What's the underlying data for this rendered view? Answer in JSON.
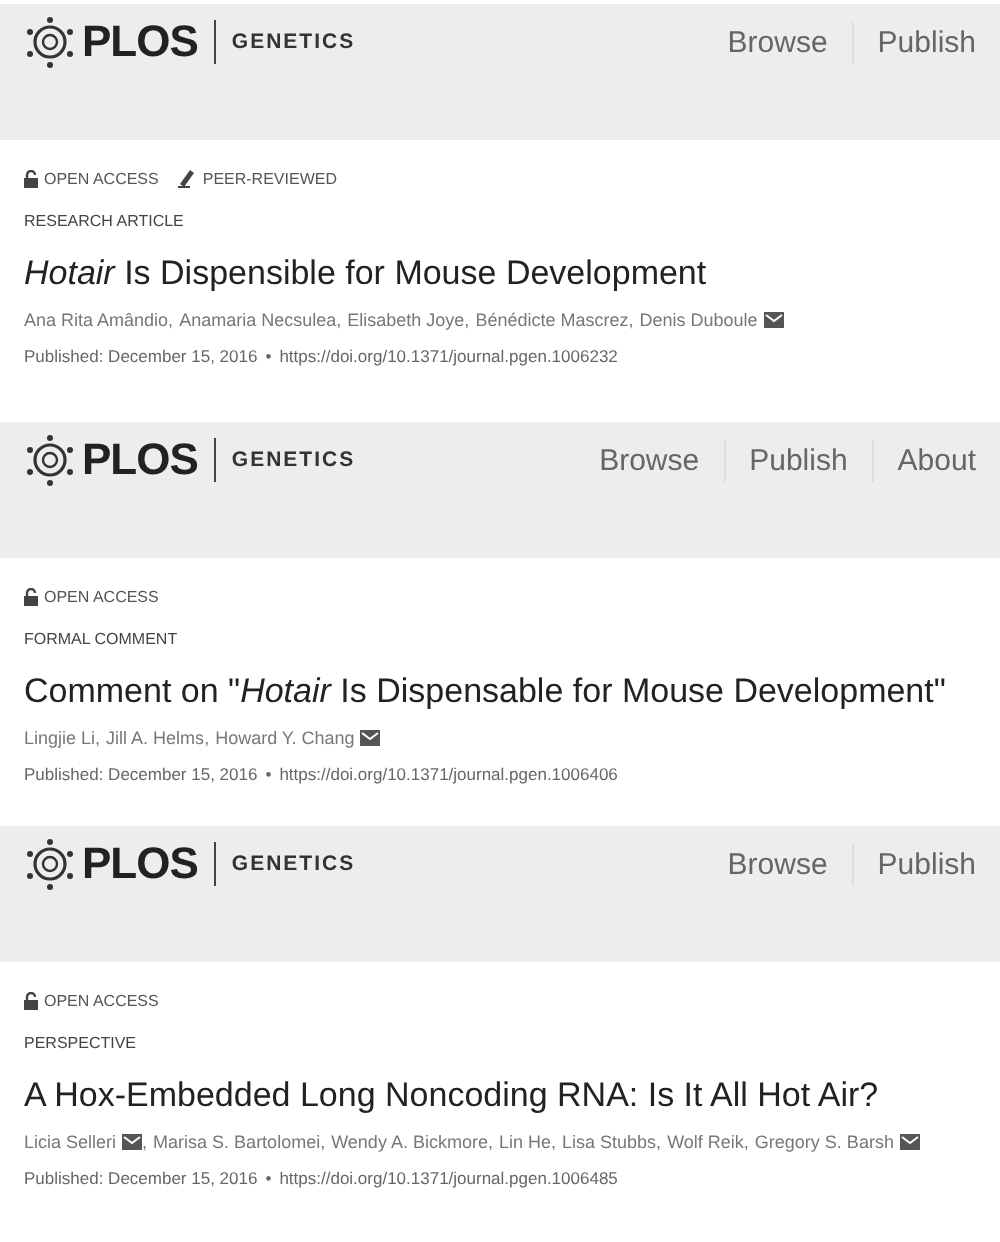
{
  "pages": [
    {
      "logo": {
        "brand": "PLOS",
        "journal": "GENETICS"
      },
      "nav": [
        "Browse",
        "Publish"
      ],
      "badges": [
        {
          "kind": "open-access",
          "label": "OPEN ACCESS"
        },
        {
          "kind": "peer-reviewed",
          "label": "PEER-REVIEWED"
        }
      ],
      "article_type": "RESEARCH ARTICLE",
      "title": "*Hotair* Is Dispensible for Mouse Development",
      "authors": [
        {
          "name": "Ana Rita Amândio",
          "corresponding": false,
          "sep": ","
        },
        {
          "name": "Anamaria Necsulea",
          "corresponding": false,
          "sep": ","
        },
        {
          "name": "Elisabeth Joye",
          "corresponding": false,
          "sep": ","
        },
        {
          "name": "Bénédicte Mascrez",
          "corresponding": false,
          "sep": ","
        },
        {
          "name": "Denis Duboule",
          "corresponding": true
        }
      ],
      "published": "Published: December 15, 2016",
      "bullet": "•",
      "doi": "https://doi.org/10.1371/journal.pgen.1006232"
    },
    {
      "logo": {
        "brand": "PLOS",
        "journal": "GENETICS"
      },
      "nav": [
        "Browse",
        "Publish",
        "About"
      ],
      "badges": [
        {
          "kind": "open-access",
          "label": "OPEN ACCESS"
        }
      ],
      "article_type": "FORMAL COMMENT",
      "title": "Comment on \"*Hotair* Is Dispensable for Mouse Development\"",
      "authors": [
        {
          "name": "Lingjie Li",
          "corresponding": false,
          "sep": ","
        },
        {
          "name": "Jill A. Helms",
          "corresponding": false,
          "sep": ","
        },
        {
          "name": "Howard Y. Chang",
          "corresponding": true
        }
      ],
      "published": "Published: December 15, 2016",
      "bullet": "•",
      "doi": "https://doi.org/10.1371/journal.pgen.1006406"
    },
    {
      "logo": {
        "brand": "PLOS",
        "journal": "GENETICS"
      },
      "nav": [
        "Browse",
        "Publish"
      ],
      "badges": [
        {
          "kind": "open-access",
          "label": "OPEN ACCESS"
        }
      ],
      "article_type": "PERSPECTIVE",
      "title": "A Hox-Embedded Long Noncoding RNA: Is It All Hot Air?",
      "authors": [
        {
          "name": "Licia Selleri",
          "corresponding": true,
          "sep": ","
        },
        {
          "name": "Marisa S. Bartolomei",
          "corresponding": false,
          "sep": ","
        },
        {
          "name": "Wendy A. Bickmore",
          "corresponding": false,
          "sep": ","
        },
        {
          "name": "Lin He",
          "corresponding": false,
          "sep": ","
        },
        {
          "name": "Lisa Stubbs",
          "corresponding": false,
          "sep": ","
        },
        {
          "name": "Wolf Reik",
          "corresponding": false,
          "sep": ","
        },
        {
          "name": "Gregory S. Barsh",
          "corresponding": true
        }
      ],
      "published": "Published: December 15, 2016",
      "bullet": "•",
      "doi": "https://doi.org/10.1371/journal.pgen.1006485"
    }
  ]
}
